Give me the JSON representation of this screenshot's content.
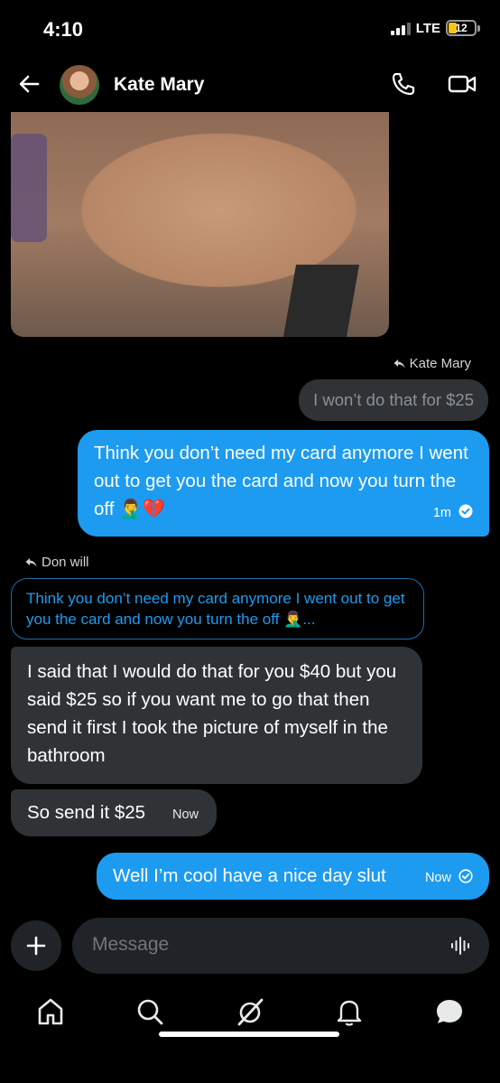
{
  "status_bar": {
    "time": "4:10",
    "network": "LTE",
    "battery": "12"
  },
  "header": {
    "contact_name": "Kate Mary"
  },
  "messages": {
    "reply_to_kate": "Kate Mary",
    "quoted_1": "I won’t do that for $25",
    "sent_1": "Think you don’t need my card anymore I went out to get you the card and now you turn the off 🤦‍♂️💔",
    "sent_1_time": "1m",
    "reply_to_don": "Don will",
    "quote_2": "Think you don’t need my card anymore I went out to get you the card and now you turn the off 🤦‍♂️...",
    "recv_1": "I said that I would do that for you $40 but you said $25 so if you want me to go that then send it first I took the picture of myself in the bathroom",
    "recv_2": "So send it $25",
    "recv_2_time": "Now",
    "sent_2": "Well I’m cool have a nice day slut",
    "sent_2_time": "Now"
  },
  "composer": {
    "placeholder": "Message"
  },
  "colors": {
    "accent": "#1d9bf0",
    "bubble_gray": "#2f3336",
    "background": "#000000"
  },
  "icons": {
    "back": "arrow-left-icon",
    "phone": "phone-icon",
    "video": "video-icon",
    "plus": "plus-icon",
    "voice": "voice-waveform-icon",
    "nav": [
      "home-icon",
      "search-icon",
      "grok-icon",
      "bell-icon",
      "messages-icon"
    ]
  }
}
